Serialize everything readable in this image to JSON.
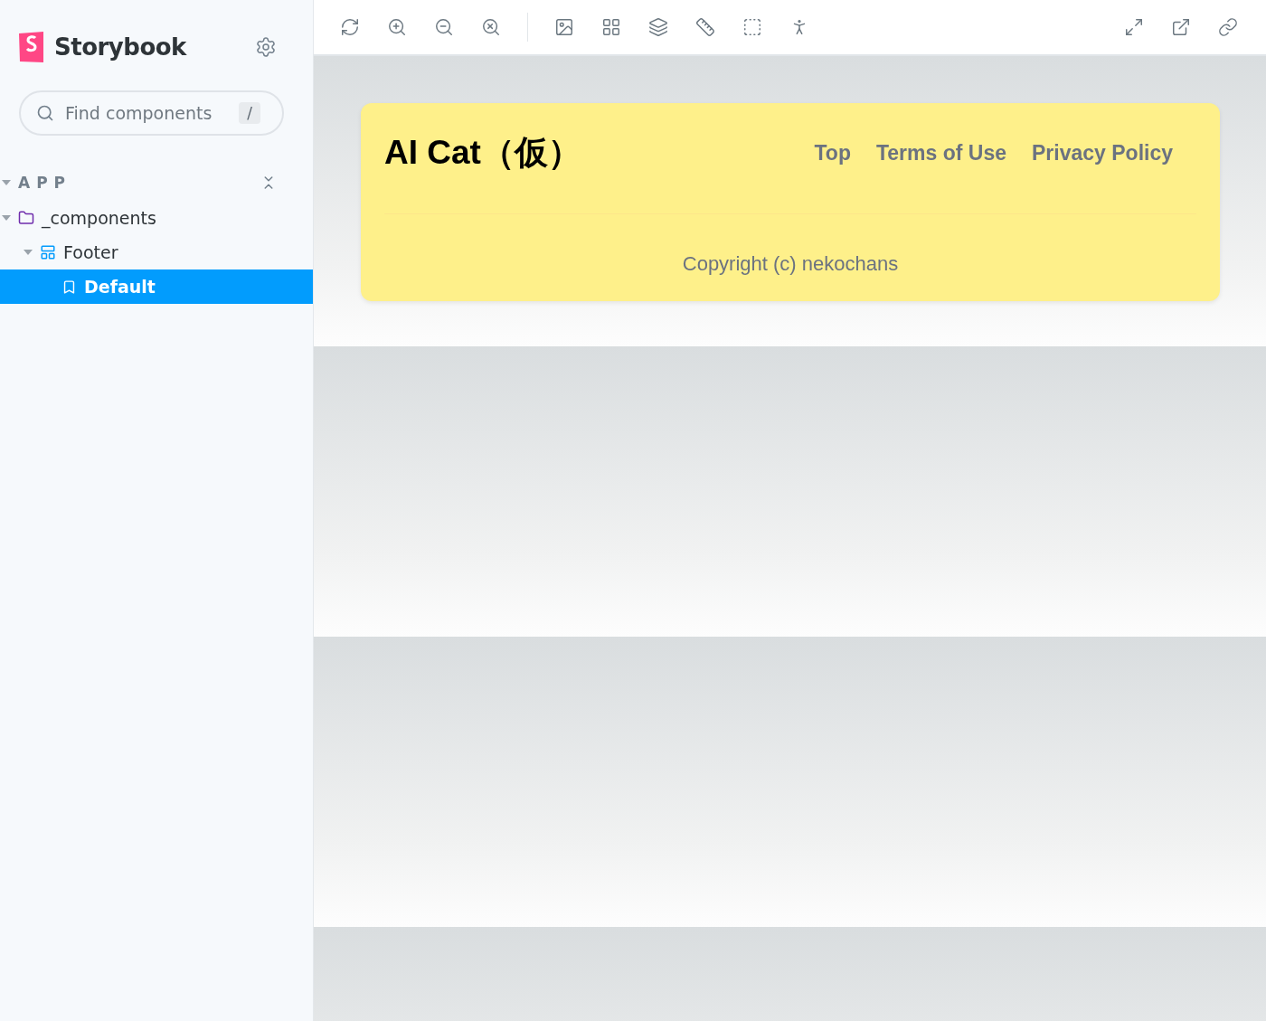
{
  "sidebar": {
    "brand": "Storybook",
    "search": {
      "placeholder": "Find components",
      "shortcut": "/"
    },
    "tree": [
      {
        "label": "APP",
        "kind": "group",
        "expanded": true,
        "selected": false,
        "children": [
          {
            "label": "_components",
            "kind": "folder",
            "expanded": true,
            "selected": false,
            "children": [
              {
                "label": "Footer",
                "kind": "component",
                "expanded": true,
                "selected": false,
                "children": [
                  {
                    "label": "Default",
                    "kind": "story",
                    "selected": true
                  }
                ]
              }
            ]
          }
        ]
      }
    ]
  },
  "preview": {
    "footer": {
      "title": "AI Cat（仮）",
      "links": [
        "Top",
        "Terms of Use",
        "Privacy Policy"
      ],
      "copyright": "Copyright (c) nekochans"
    }
  }
}
